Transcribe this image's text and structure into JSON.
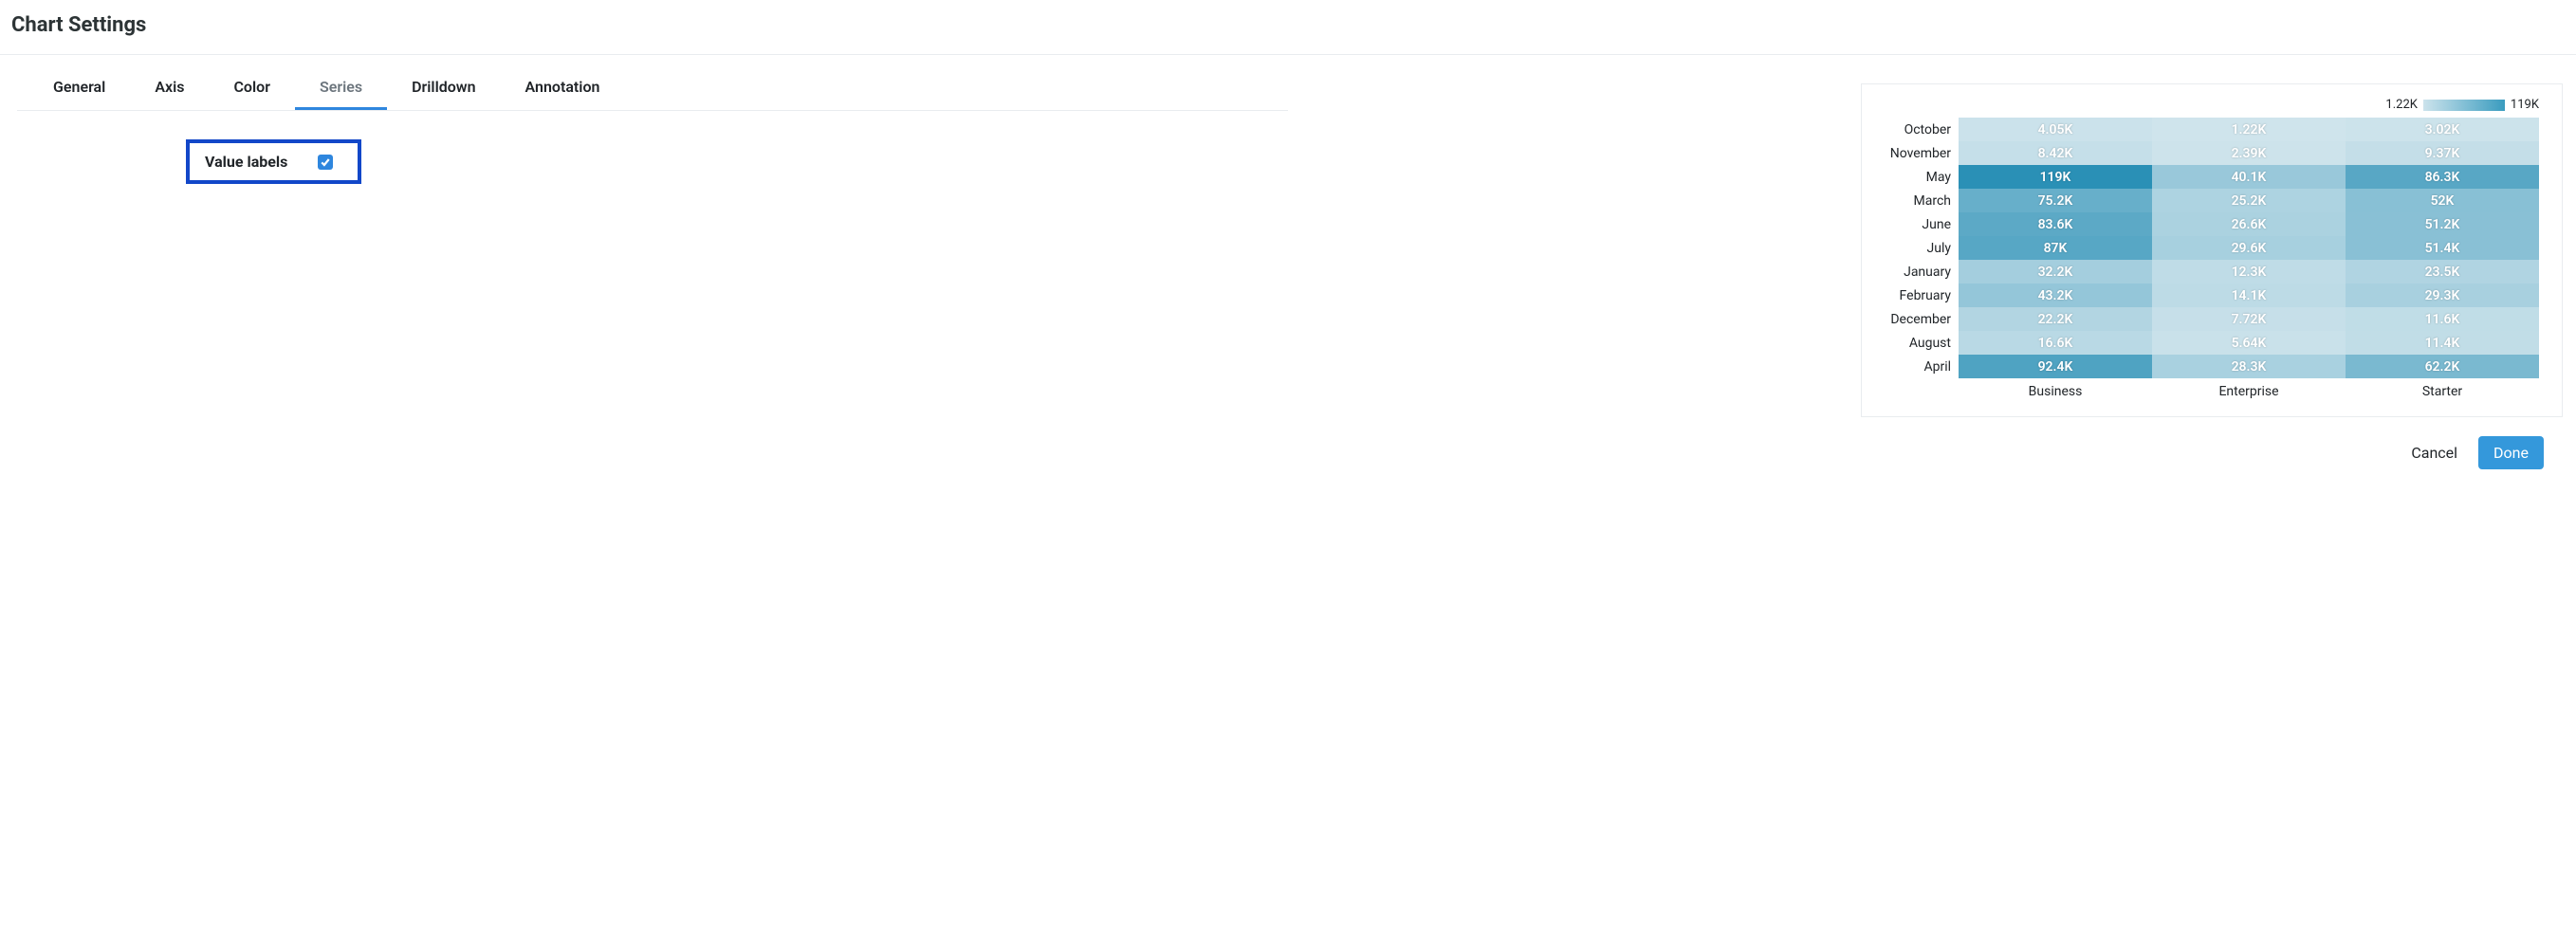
{
  "title": "Chart Settings",
  "tabs": [
    "General",
    "Axis",
    "Color",
    "Series",
    "Drilldown",
    "Annotation"
  ],
  "active_tab": "Series",
  "option": {
    "label": "Value labels",
    "checked": true
  },
  "legend": {
    "min": "1.22K",
    "max": "119K"
  },
  "footer": {
    "cancel": "Cancel",
    "done": "Done"
  },
  "chart_data": {
    "type": "heatmap",
    "value_scale_min": 1220,
    "value_scale_max": 119000,
    "color_low": "#cfe4ec",
    "color_high": "#2a90b6",
    "x_categories": [
      "Business",
      "Enterprise",
      "Starter"
    ],
    "y_categories": [
      "October",
      "November",
      "May",
      "March",
      "June",
      "July",
      "January",
      "February",
      "December",
      "August",
      "April"
    ],
    "cells": [
      {
        "y": "October",
        "x": "Business",
        "label": "4.05K",
        "value": 4050
      },
      {
        "y": "October",
        "x": "Enterprise",
        "label": "1.22K",
        "value": 1220
      },
      {
        "y": "October",
        "x": "Starter",
        "label": "3.02K",
        "value": 3020
      },
      {
        "y": "November",
        "x": "Business",
        "label": "8.42K",
        "value": 8420
      },
      {
        "y": "November",
        "x": "Enterprise",
        "label": "2.39K",
        "value": 2390
      },
      {
        "y": "November",
        "x": "Starter",
        "label": "9.37K",
        "value": 9370
      },
      {
        "y": "May",
        "x": "Business",
        "label": "119K",
        "value": 119000
      },
      {
        "y": "May",
        "x": "Enterprise",
        "label": "40.1K",
        "value": 40100
      },
      {
        "y": "May",
        "x": "Starter",
        "label": "86.3K",
        "value": 86300
      },
      {
        "y": "March",
        "x": "Business",
        "label": "75.2K",
        "value": 75200
      },
      {
        "y": "March",
        "x": "Enterprise",
        "label": "25.2K",
        "value": 25200
      },
      {
        "y": "March",
        "x": "Starter",
        "label": "52K",
        "value": 52000
      },
      {
        "y": "June",
        "x": "Business",
        "label": "83.6K",
        "value": 83600
      },
      {
        "y": "June",
        "x": "Enterprise",
        "label": "26.6K",
        "value": 26600
      },
      {
        "y": "June",
        "x": "Starter",
        "label": "51.2K",
        "value": 51200
      },
      {
        "y": "July",
        "x": "Business",
        "label": "87K",
        "value": 87000
      },
      {
        "y": "July",
        "x": "Enterprise",
        "label": "29.6K",
        "value": 29600
      },
      {
        "y": "July",
        "x": "Starter",
        "label": "51.4K",
        "value": 51400
      },
      {
        "y": "January",
        "x": "Business",
        "label": "32.2K",
        "value": 32200
      },
      {
        "y": "January",
        "x": "Enterprise",
        "label": "12.3K",
        "value": 12300
      },
      {
        "y": "January",
        "x": "Starter",
        "label": "23.5K",
        "value": 23500
      },
      {
        "y": "February",
        "x": "Business",
        "label": "43.2K",
        "value": 43200
      },
      {
        "y": "February",
        "x": "Enterprise",
        "label": "14.1K",
        "value": 14100
      },
      {
        "y": "February",
        "x": "Starter",
        "label": "29.3K",
        "value": 29300
      },
      {
        "y": "December",
        "x": "Business",
        "label": "22.2K",
        "value": 22200
      },
      {
        "y": "December",
        "x": "Enterprise",
        "label": "7.72K",
        "value": 7720
      },
      {
        "y": "December",
        "x": "Starter",
        "label": "11.6K",
        "value": 11600
      },
      {
        "y": "August",
        "x": "Business",
        "label": "16.6K",
        "value": 16600
      },
      {
        "y": "August",
        "x": "Enterprise",
        "label": "5.64K",
        "value": 5640
      },
      {
        "y": "August",
        "x": "Starter",
        "label": "11.4K",
        "value": 11400
      },
      {
        "y": "April",
        "x": "Business",
        "label": "92.4K",
        "value": 92400
      },
      {
        "y": "April",
        "x": "Enterprise",
        "label": "28.3K",
        "value": 28300
      },
      {
        "y": "April",
        "x": "Starter",
        "label": "62.2K",
        "value": 62200
      }
    ]
  }
}
